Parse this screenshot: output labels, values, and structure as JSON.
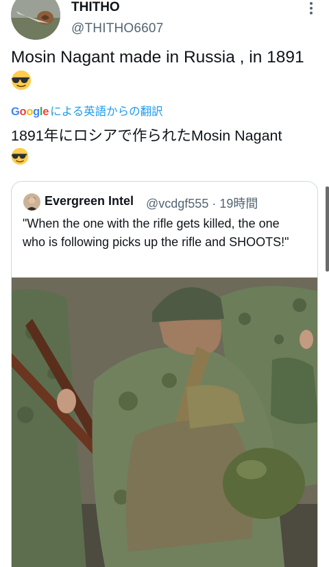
{
  "author": {
    "display_name": "THITHO",
    "handle": "@THITHO6607"
  },
  "tweet": {
    "text": "Mosin Nagant made in Russia , in 1891",
    "emoji": "smiling-face-with-sunglasses"
  },
  "translation": {
    "google_logo": [
      "G",
      "o",
      "o",
      "g",
      "l",
      "e"
    ],
    "label": "による英語からの翻訳",
    "text": "1891年にロシアで作られたMosin Nagant"
  },
  "quoted_tweet": {
    "display_name": "Evergreen Intel",
    "handle": "@vcdgf555",
    "separator": "·",
    "time": "19時間",
    "text": "\"When the one with the rifle gets killed, the one who is following picks up the rifle and SHOOTS!\"",
    "image_description_icon": "photo"
  },
  "colors": {
    "accent": "#1d9bf0",
    "secondary_text": "#536471",
    "border": "#cfd9de"
  }
}
